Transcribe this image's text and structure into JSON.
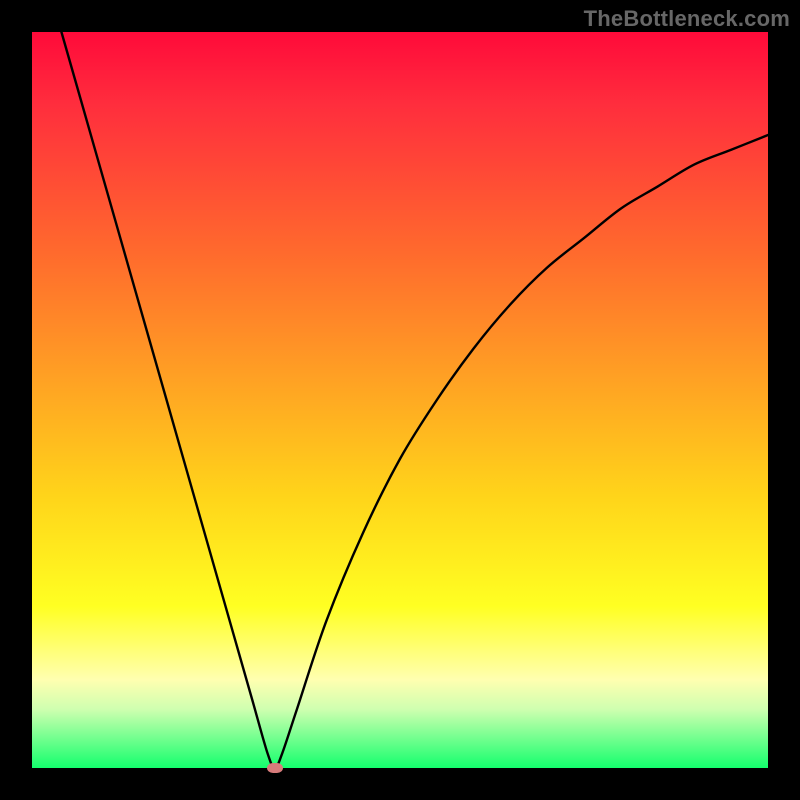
{
  "watermark": "TheBottleneck.com",
  "chart_data": {
    "type": "line",
    "title": "",
    "xlabel": "",
    "ylabel": "",
    "xlim": [
      0,
      100
    ],
    "ylim": [
      0,
      100
    ],
    "series": [
      {
        "name": "bottleneck-curve",
        "x": [
          4,
          8,
          12,
          16,
          20,
          24,
          28,
          30,
          32,
          33,
          34,
          36,
          40,
          45,
          50,
          55,
          60,
          65,
          70,
          75,
          80,
          85,
          90,
          95,
          100
        ],
        "y": [
          100,
          86,
          72,
          58,
          44,
          30,
          16,
          9,
          2,
          0,
          2,
          8,
          20,
          32,
          42,
          50,
          57,
          63,
          68,
          72,
          76,
          79,
          82,
          84,
          86
        ]
      }
    ],
    "gradient_stops": [
      {
        "pos": 0.0,
        "color": "#ff0a3a"
      },
      {
        "pos": 0.1,
        "color": "#ff2e3d"
      },
      {
        "pos": 0.3,
        "color": "#ff6a2d"
      },
      {
        "pos": 0.48,
        "color": "#ffa423"
      },
      {
        "pos": 0.63,
        "color": "#ffd41a"
      },
      {
        "pos": 0.78,
        "color": "#ffff22"
      },
      {
        "pos": 0.88,
        "color": "#ffffb0"
      },
      {
        "pos": 0.92,
        "color": "#cfffb0"
      },
      {
        "pos": 1.0,
        "color": "#14ff6d"
      }
    ],
    "marker": {
      "x": 33,
      "y": 0,
      "color": "#d77b7b"
    }
  },
  "colors": {
    "frame": "#000000",
    "curve": "#000000",
    "watermark": "#676767"
  }
}
